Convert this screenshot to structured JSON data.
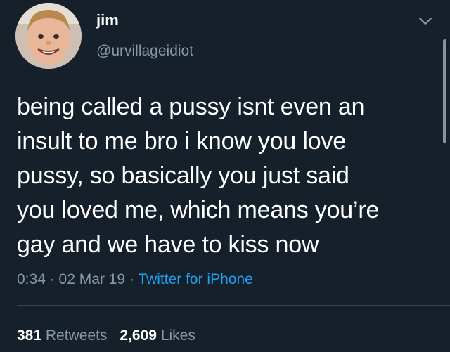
{
  "user": {
    "display_name": "jim",
    "handle": "@urvillageidiot",
    "avatar_icon": "avatar-photo"
  },
  "tweet": {
    "text": "being called a pussy isnt even an\ninsult to me bro i know you love\npussy, so basically you just said\nyou loved me, which means you’re\ngay and we have to kiss now",
    "time": "0:34",
    "separator": " · ",
    "date": "02 Mar 19",
    "source": "Twitter for iPhone"
  },
  "stats": {
    "retweets_count": "381",
    "retweets_label": " Retweets",
    "likes_count": "2,609",
    "likes_label": " Likes"
  },
  "colors": {
    "background": "#15202b",
    "text": "#ffffff",
    "muted": "#8899a6",
    "link": "#1da1f2",
    "divider": "#38444d"
  },
  "icons": {
    "more": "chevron-down-icon"
  }
}
